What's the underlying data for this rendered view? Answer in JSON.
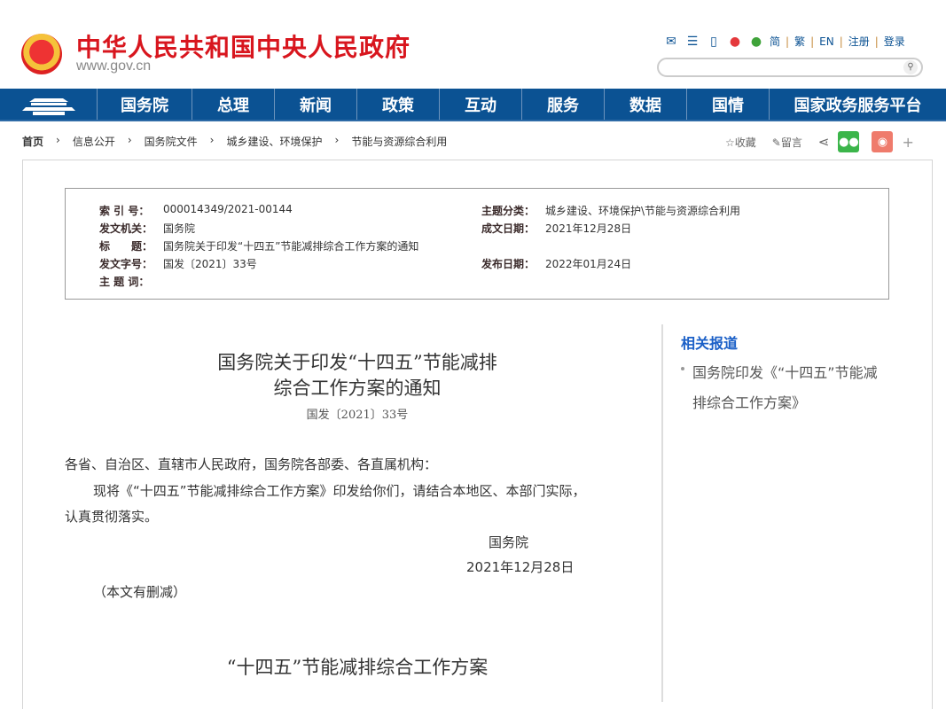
{
  "header": {
    "site_title": "中华人民共和国中央人民政府",
    "domain": "www.gov.cn",
    "lang_links": [
      "简",
      "繁",
      "EN",
      "注册",
      "登录"
    ],
    "search_placeholder": ""
  },
  "nav": [
    "国务院",
    "总理",
    "新闻",
    "政策",
    "互动",
    "服务",
    "数据",
    "国情",
    "国家政务服务平台"
  ],
  "breadcrumb": [
    "首页",
    "信息公开",
    "国务院文件",
    "城乡建设、环境保护",
    "节能与资源综合利用"
  ],
  "tools": {
    "favorite": "收藏",
    "comment": "留言",
    "plus": "+"
  },
  "meta": {
    "index_label": "索 引 号：",
    "index": "000014349/2021-00144",
    "issuer_label": "发文机关：",
    "issuer": "国务院",
    "title_label": "标　　题：",
    "title": "国务院关于印发“十四五”节能减排综合工作方案的通知",
    "docno_label": "发文字号：",
    "docno": "国发〔2021〕33号",
    "keywords_label": "主 题 词：",
    "category_label": "主题分类：",
    "category": "城乡建设、环境保护\\节能与资源综合利用",
    "written_label": "成文日期：",
    "written": "2021年12月28日",
    "published_label": "发布日期：",
    "published": "2022年01月24日"
  },
  "article": {
    "title1": "国务院关于印发“十四五”节能减排",
    "title2": "综合工作方案的通知",
    "docno": "国发〔2021〕33号",
    "salutation": "各省、自治区、直辖市人民政府，国务院各部委、各直属机构：",
    "body1": "现将《“十四五”节能减排综合工作方案》印发给你们，请结合本地区、本部门实际，",
    "body2": "认真贯彻落实。",
    "sign": "国务院",
    "date": "2021年12月28日",
    "note": "（本文有删减）",
    "subtitle": "“十四五”节能减排综合工作方案"
  },
  "related": {
    "heading": "相关报道",
    "items": [
      "国务院印发《“十四五”节能减排综合工作方案》"
    ]
  }
}
